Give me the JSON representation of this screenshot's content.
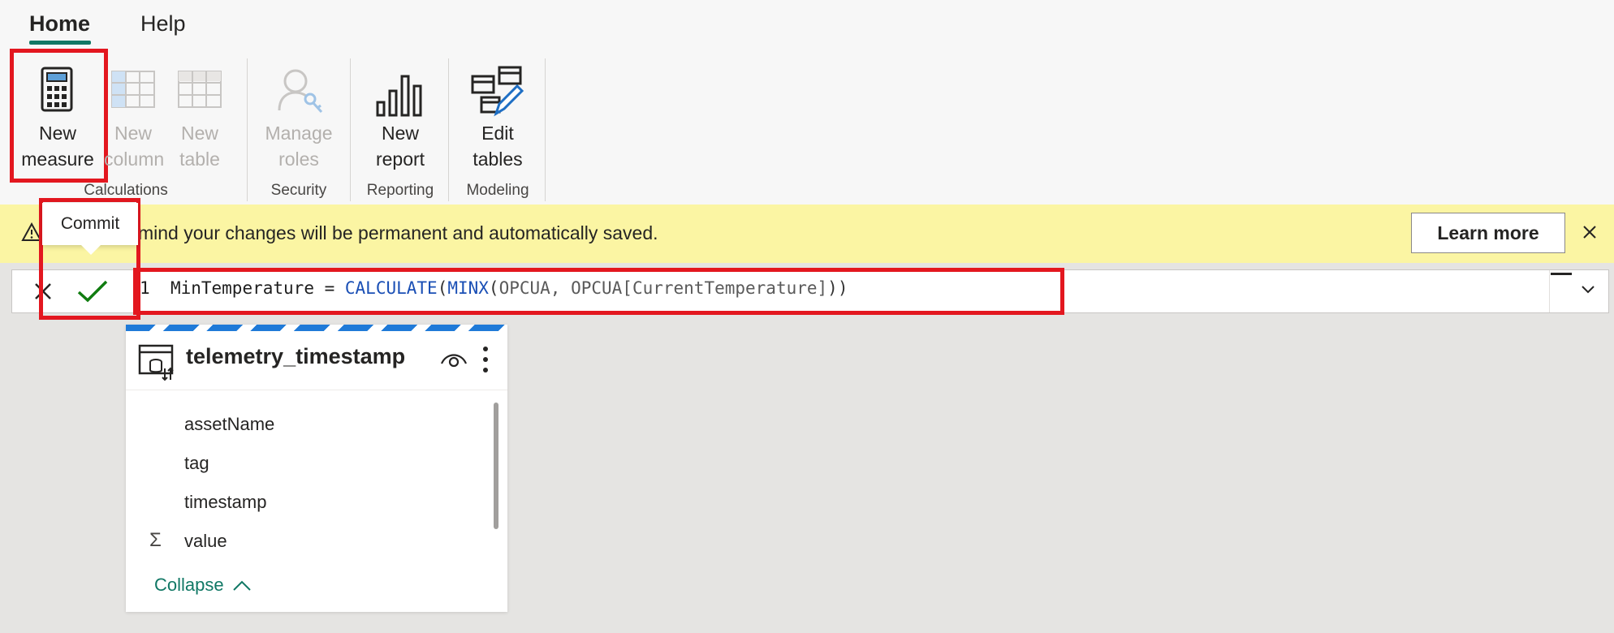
{
  "ribbon": {
    "tabs": [
      {
        "label": "Home",
        "active": true
      },
      {
        "label": "Help",
        "active": false
      }
    ],
    "buttons": {
      "new_measure": {
        "line1": "New",
        "line2": "measure",
        "enabled": true
      },
      "new_column": {
        "line1": "New",
        "line2": "column",
        "enabled": false
      },
      "new_table": {
        "line1": "New",
        "line2": "table",
        "enabled": false
      },
      "manage_roles": {
        "line1": "Manage",
        "line2": "roles",
        "enabled": false
      },
      "new_report": {
        "line1": "New",
        "line2": "report",
        "enabled": true
      },
      "edit_tables": {
        "line1": "Edit",
        "line2": "tables",
        "enabled": true
      }
    },
    "groups": {
      "calculations": "Calculations",
      "security": "Security",
      "reporting": "Reporting",
      "modeling": "Modeling"
    }
  },
  "banner": {
    "text": "mind your changes will be permanent and automatically saved.",
    "learn_more": "Learn more",
    "icon": "warning-icon"
  },
  "tooltip": {
    "text": "Commit"
  },
  "formula_bar": {
    "line_number": "1",
    "tokens": {
      "lhs": "MinTemperature = ",
      "fn1": "CALCULATE",
      "open1": "(",
      "fn2": "MINX",
      "open2": "(",
      "arg1": "OPCUA, ",
      "arg2": "OPCUA[CurrentTemperature]",
      "close": "))"
    }
  },
  "table_card": {
    "title": "telemetry_timestamp",
    "fields": [
      {
        "name": "assetName",
        "icon": ""
      },
      {
        "name": "tag",
        "icon": ""
      },
      {
        "name": "timestamp",
        "icon": ""
      },
      {
        "name": "value",
        "icon": "Σ"
      }
    ],
    "collapse_label": "Collapse"
  },
  "colors": {
    "accent": "#117865",
    "highlight": "#e3171f",
    "banner_bg": "#fbf5a3",
    "keyword": "#1a4fb5",
    "commit_check": "#107c10"
  }
}
